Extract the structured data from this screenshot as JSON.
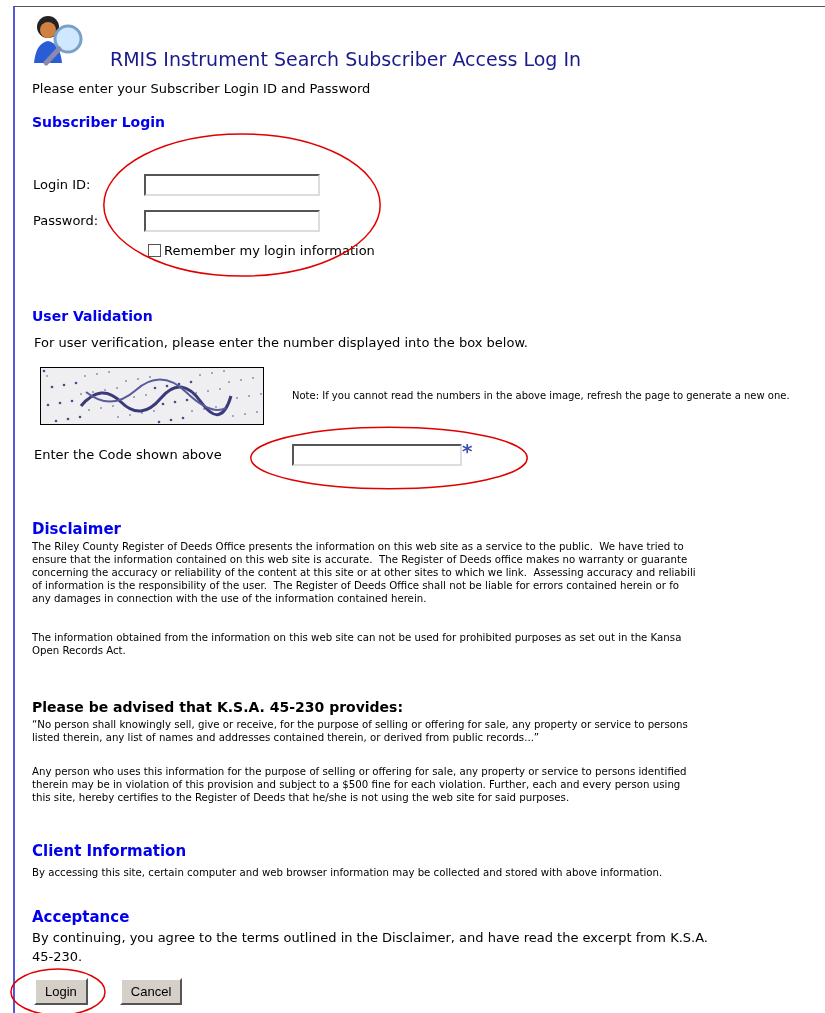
{
  "title": "RMIS Instrument Search Subscriber Access Log In",
  "intro": "Please enter your Subscriber Login ID and Password",
  "login_section": {
    "heading": "Subscriber Login",
    "fields": [
      {
        "label": "Login ID:"
      },
      {
        "label": "Password:"
      }
    ],
    "remember": {
      "label": "Remember my login information",
      "checked": false
    }
  },
  "validation_section": {
    "heading": "User Validation",
    "instruction": "For user verification, please enter the number displayed into the box below.",
    "note": "Note: If you cannot read the numbers in the above image, refresh the page to generate a new one.",
    "code_label": "Enter the Code shown above",
    "required_mark": "*"
  },
  "disclaimer": {
    "heading": "Disclaimer",
    "paragraphs": [
      [
        "The Riley County Register of Deeds Office presents the information on this web site as a service to the public.  We have tried to",
        "ensure that the information contained on this web site is accurate.  The Register of Deeds office makes no warranty or guarante",
        "concerning the accuracy or reliability of the content at this site or at other sites to which we link.  Assessing accuracy and reliabili",
        "of information is the responsibility of the user.  The Register of Deeds Office shall not be liable for errors contained herein or fo",
        "any damages in connection with the use of the information contained herein."
      ],
      [
        "The information obtained from the information on this web site can not be used for prohibited purposes as set out in the Kansa",
        "Open Records Act."
      ]
    ]
  },
  "statute": {
    "heading": "Please be advised that K.S.A. 45-230 provides:",
    "paragraphs": [
      [
        "“No person shall knowingly sell, give or receive, for the purpose of selling or offering for sale, any property or service to persons",
        "listed therein, any list of names and addresses contained therein, or derived from public records...”"
      ],
      [
        "Any person who uses this information for the purpose of selling or offering for sale, any property or service to persons identified",
        "therein may be in violation of this provision and subject to a $500 fine for each violation. Further, each and every person using",
        "this site, hereby certifies to the Register of Deeds that he/she is not using the web site for said purposes."
      ]
    ]
  },
  "client_info": {
    "heading": "Client Information",
    "text": "By accessing this site, certain computer and web browser information may be collected and stored with above information."
  },
  "acceptance": {
    "heading": "Acceptance",
    "text": "By continuing, you agree to the terms outlined in the Disclaimer, and have read the excerpt from K.S.A. 45-230."
  },
  "buttons": [
    "Login",
    "Cancel"
  ]
}
